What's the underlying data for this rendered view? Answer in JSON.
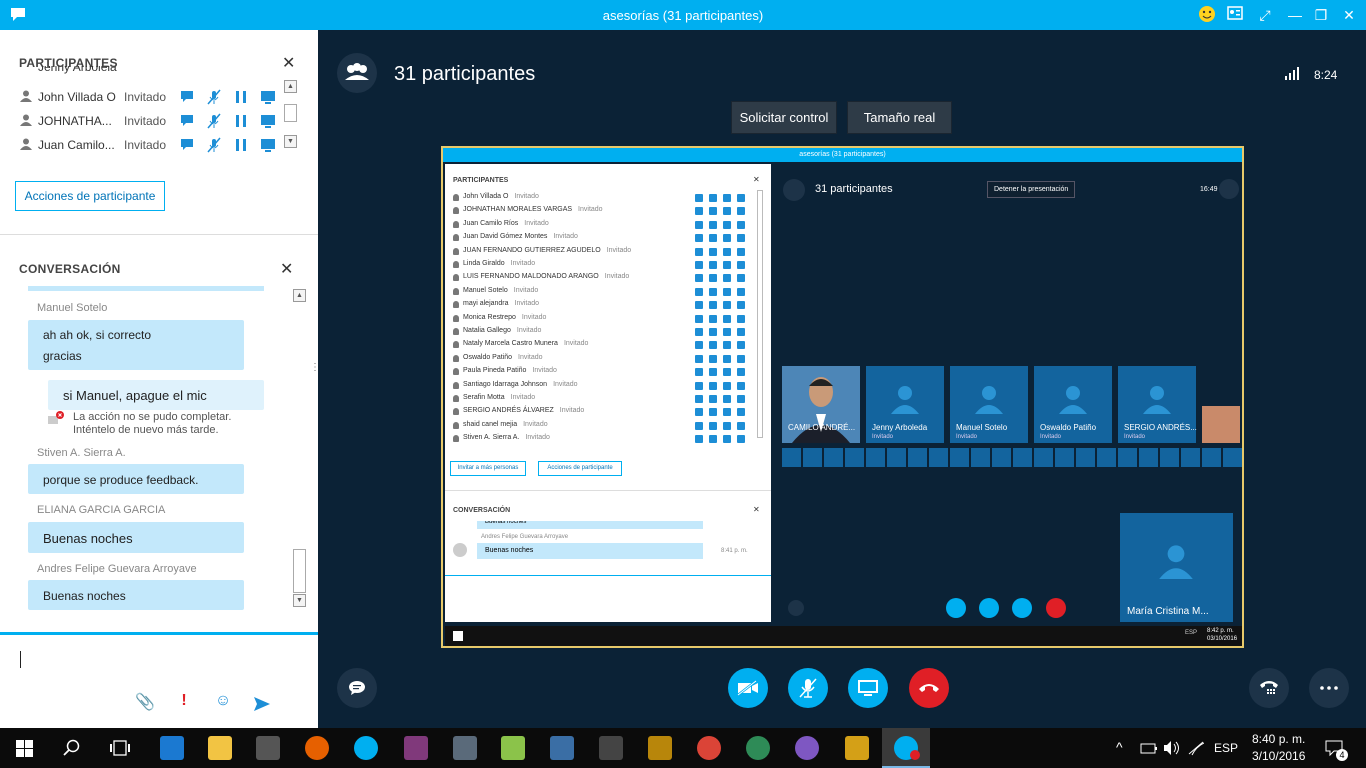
{
  "window": {
    "title": "asesorías (31 participantes)"
  },
  "sidebar": {
    "participants_title": "PARTICIPANTES",
    "partial_row": "Jenny Arbolela",
    "participants": [
      {
        "name": "John Villada O",
        "status": "Invitado"
      },
      {
        "name": "JOHNATHA...",
        "status": "Invitado"
      },
      {
        "name": "Juan Camilo...",
        "status": "Invitado"
      }
    ],
    "participant_actions_label": "Acciones de participante",
    "conversation_title": "CONVERSACIÓN",
    "messages": [
      {
        "sender": "Manuel Sotelo",
        "lines": [
          "ah ah ok, si correcto",
          "gracias"
        ]
      },
      {
        "sender": "",
        "mine": "si Manuel, apague el mic",
        "error": [
          "La acción no se pudo completar.",
          "Inténtelo de nuevo más tarde."
        ]
      },
      {
        "sender": "Stiven A. Sierra A.",
        "lines": [
          "porque se produce feedback."
        ]
      },
      {
        "sender": "ELIANA GARCIA GARCIA",
        "lines": [
          "Buenas noches"
        ]
      },
      {
        "sender": "Andres Felipe Guevara Arroyave",
        "lines": [
          "Buenas noches"
        ]
      }
    ]
  },
  "stage": {
    "title": "31 participantes",
    "time": "8:24",
    "request_control_label": "Solicitar control",
    "actual_size_label": "Tamaño real"
  },
  "shared_screen": {
    "title": "asesorías (31 participantes)",
    "participants_title": "PARTICIPANTES",
    "participants": [
      {
        "name": "John Villada O",
        "status": "Invitado"
      },
      {
        "name": "JOHNATHAN MORALES VARGAS",
        "status": "Invitado"
      },
      {
        "name": "Juan Camilo Ríos",
        "status": "Invitado"
      },
      {
        "name": "Juan David Gómez Montes",
        "status": "Invitado"
      },
      {
        "name": "JUAN FERNANDO GUTIERREZ AGUDELO",
        "status": "Invitado"
      },
      {
        "name": "Linda Giraldo",
        "status": "Invitado"
      },
      {
        "name": "LUIS FERNANDO MALDONADO ARANGO",
        "status": "Invitado"
      },
      {
        "name": "Manuel Sotelo",
        "status": "Invitado"
      },
      {
        "name": "mayi alejandra",
        "status": "Invitado"
      },
      {
        "name": "Monica Restrepo",
        "status": "Invitado"
      },
      {
        "name": "Natalia Gallego",
        "status": "Invitado"
      },
      {
        "name": "Nataly Marcela Castro Munera",
        "status": "Invitado"
      },
      {
        "name": "Oswaldo Patiño",
        "status": "Invitado"
      },
      {
        "name": "Paula Pineda Patiño",
        "status": "Invitado"
      },
      {
        "name": "Santiago Idarraga Johnson",
        "status": "Invitado"
      },
      {
        "name": "Serafin Motta",
        "status": "Invitado"
      },
      {
        "name": "SERGIO ANDRÉS ÁLVAREZ",
        "status": "Invitado"
      },
      {
        "name": "shaid canel mejia",
        "status": "Invitado"
      },
      {
        "name": "Stiven A. Sierra A.",
        "status": "Invitado"
      }
    ],
    "invite_label": "Invitar a más personas",
    "actions_label": "Acciones de participante",
    "conversation_title": "CONVERSACIÓN",
    "conv_partial": "Buenas noches",
    "conv_sender": "Andres Felipe Guevara Arroyave",
    "conv_message": "Buenas noches",
    "conv_time": "8:41 p. m.",
    "stage_title": "31 participantes",
    "stop_presenting": "Detener la presentación",
    "stage_time": "16:49",
    "tiles": [
      {
        "name": "CAMILO ANDRÉ...",
        "status": ""
      },
      {
        "name": "Jenny Arboleda",
        "status": "Invitado"
      },
      {
        "name": "Manuel Sotelo",
        "status": "Invitado"
      },
      {
        "name": "Oswaldo Patiño",
        "status": "Invitado"
      },
      {
        "name": "SERGIO ANDRÉS...",
        "status": "Invitado"
      }
    ],
    "self_view_name": "María Cristina M...",
    "clock_time": "8:42 p. m.",
    "clock_date": "03/10/2016",
    "lang": "ESP"
  },
  "taskbar": {
    "time": "8:40 p. m.",
    "date": "3/10/2016",
    "lang": "ESP",
    "notifications": "4"
  },
  "colors": {
    "skype_blue": "#00aff0",
    "stage_bg": "#0b2236",
    "hangup_red": "#e01f26"
  }
}
